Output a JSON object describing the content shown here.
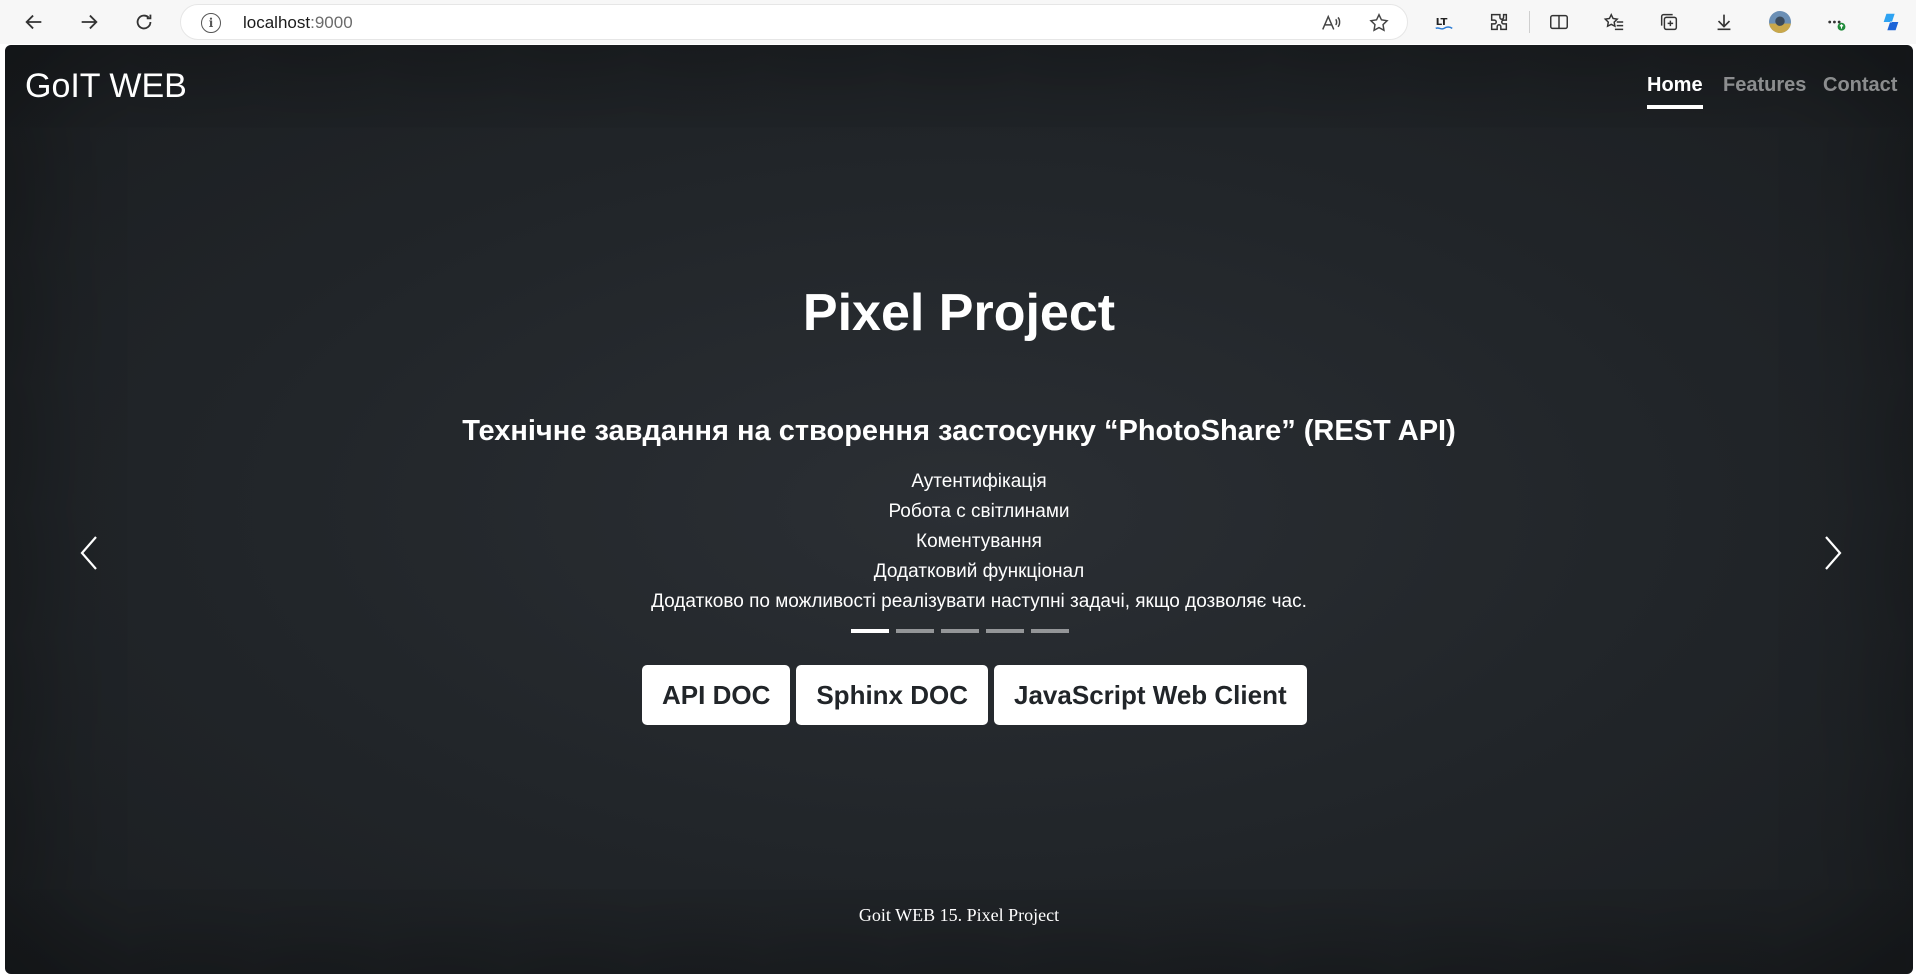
{
  "browser": {
    "url_host": "localhost",
    "url_port": ":9000",
    "info_glyph": "i",
    "icons": [
      "back-icon",
      "forward-icon",
      "reload-icon",
      "info-icon",
      "read-aloud-icon",
      "favorite-star-icon",
      "lt-extension-icon",
      "extensions-icon",
      "split-screen-icon",
      "favorites-icon",
      "collections-icon",
      "downloads-icon",
      "profile-avatar",
      "more-icon",
      "copilot-icon"
    ]
  },
  "nav": {
    "brand": "GoIT WEB",
    "links": [
      {
        "label": "Home",
        "active": true
      },
      {
        "label": "Features",
        "active": false
      },
      {
        "label": "Contact",
        "active": false
      }
    ]
  },
  "hero": {
    "title": "Pixel Project",
    "slide": {
      "heading": "Технічне завдання на створення застосунку “PhotoShare” (REST API)",
      "items": [
        "Аутентифікація",
        "Робота с світлинами",
        "Коментування",
        "Додатковий функціонал",
        "Додатково по можливості реалізувати наступні задачі, якщо дозволяє час."
      ]
    },
    "indicator_count": 5,
    "active_indicator": 0
  },
  "buttons": [
    "API DOC",
    "Sphinx DOC",
    "JavaScript Web Client"
  ],
  "footer": "Goit WEB 15. Pixel Project",
  "colors": {
    "page_bg": "#212529",
    "text": "#ffffff",
    "button_bg": "#ffffff",
    "button_text": "#212529"
  }
}
